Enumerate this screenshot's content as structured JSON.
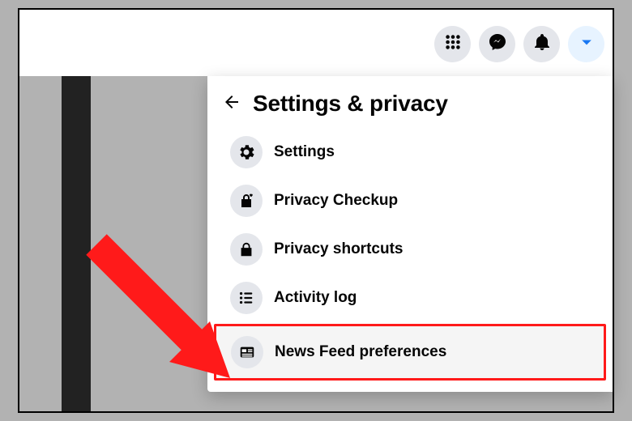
{
  "panel": {
    "title": "Settings & privacy"
  },
  "menu": {
    "settings": "Settings",
    "privacy_checkup": "Privacy Checkup",
    "privacy_shortcuts": "Privacy shortcuts",
    "activity_log": "Activity log",
    "news_feed": "News Feed preferences"
  }
}
